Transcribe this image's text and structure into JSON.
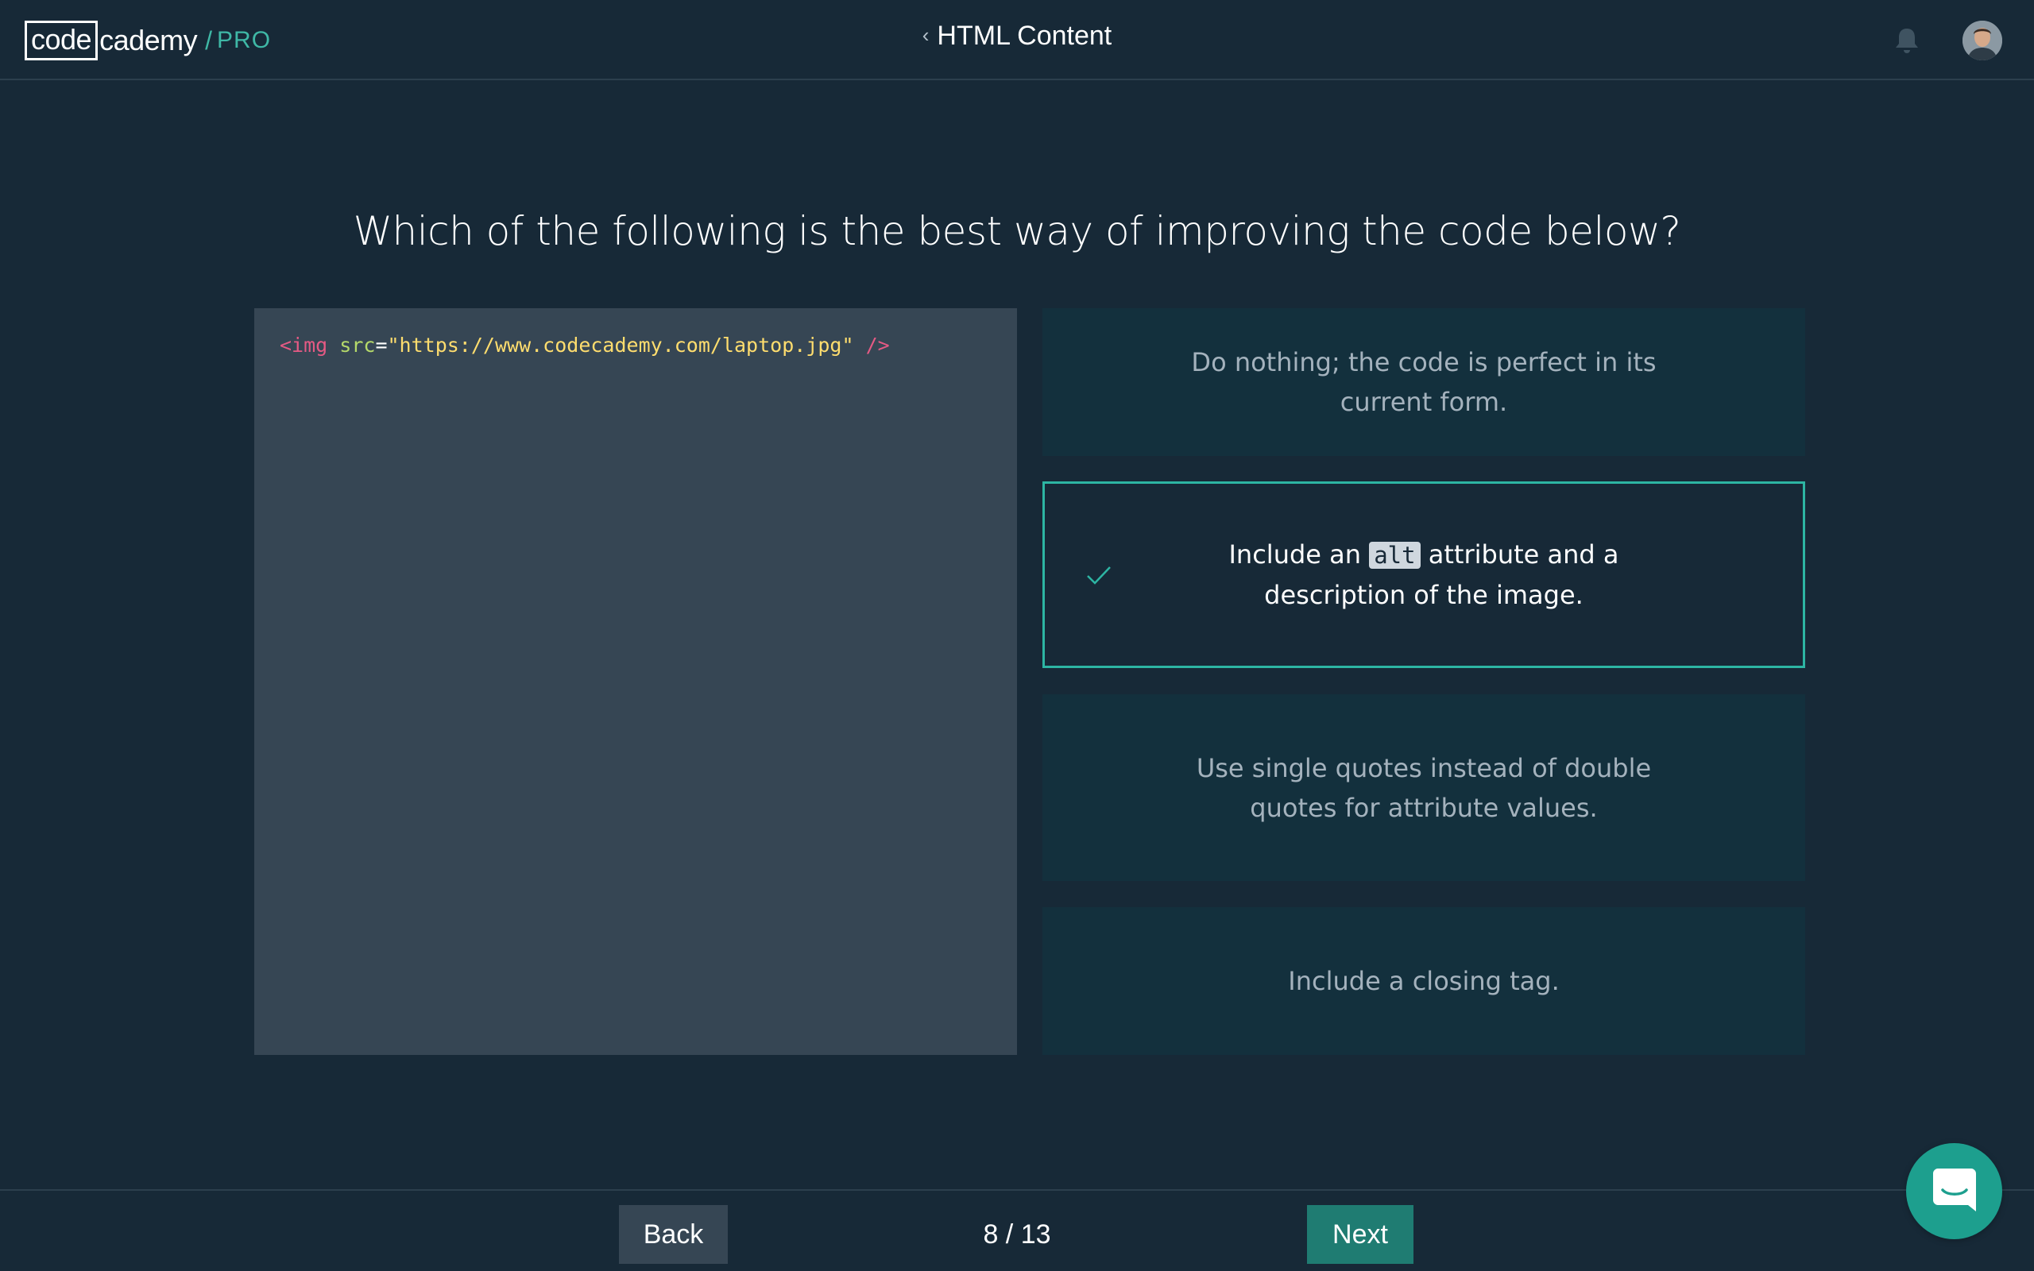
{
  "header": {
    "logo": {
      "box_text": "code",
      "rest_text": "cademy",
      "slash": "/",
      "pro": "PRO"
    },
    "course_title": "HTML Content",
    "back_chevron_icon": "chevron-left-icon",
    "notification_icon": "bell-icon",
    "avatar_icon": "user-avatar"
  },
  "question": "Which of the following is the best way of improving the code below?",
  "code": {
    "tag_open": "<img",
    "attr": "src",
    "eq": "=",
    "value": "\"https://www.codecademy.com/laptop.jpg\"",
    "tag_close": "/>"
  },
  "options": [
    {
      "text": "Do nothing; the code is perfect in its current form.",
      "selected": false
    },
    {
      "text_before": "Include an ",
      "code": "alt",
      "text_after": " attribute and a description of the image.",
      "selected": true
    },
    {
      "text": "Use single quotes instead of double quotes for attribute values.",
      "selected": false
    },
    {
      "text": "Include a closing tag.",
      "selected": false
    }
  ],
  "footer": {
    "back_label": "Back",
    "next_label": "Next",
    "progress": "8 / 13"
  },
  "chat_icon": "chat-icon",
  "colors": {
    "background": "#172937",
    "accent": "#2db5a3",
    "next_button": "#1f7c72",
    "code_panel": "#364654",
    "option_bg": "#13303d"
  }
}
